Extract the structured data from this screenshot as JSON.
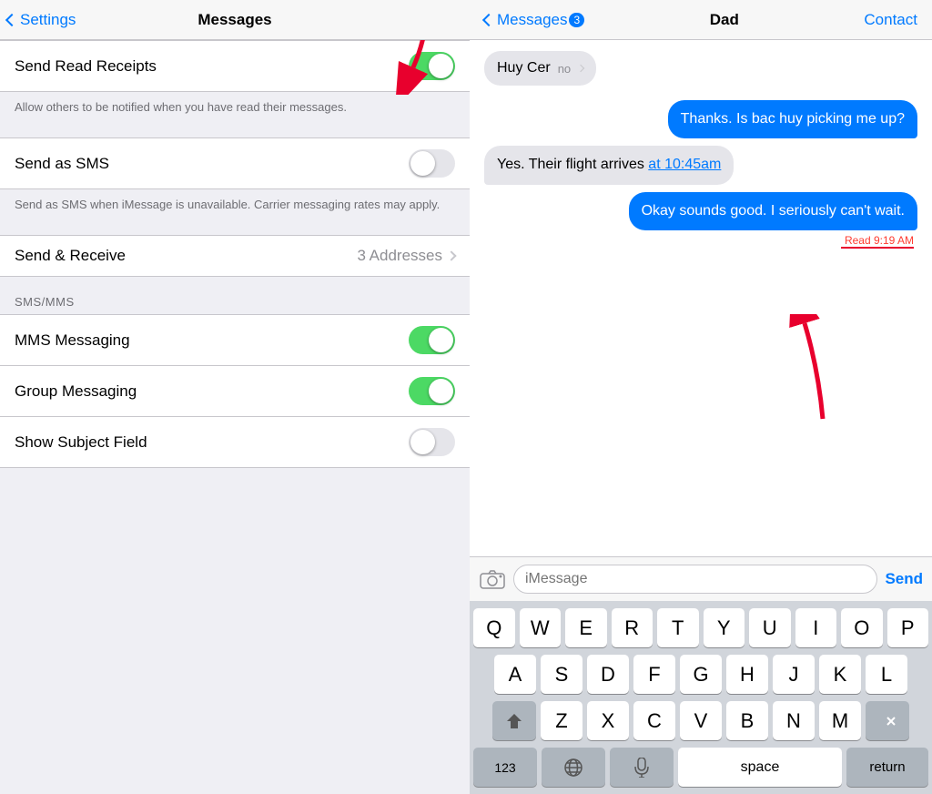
{
  "settings": {
    "nav": {
      "back_label": "Settings",
      "title": "Messages"
    },
    "items": {
      "send_read_receipts": {
        "label": "Send Read Receipts",
        "toggle_state": "on",
        "description": "Allow others to be notified when you have read their messages."
      },
      "send_as_sms": {
        "label": "Send as SMS",
        "toggle_state": "off",
        "description": "Send as SMS when iMessage is unavailable. Carrier messaging rates may apply."
      },
      "send_receive": {
        "label": "Send & Receive",
        "value": "3 Addresses"
      },
      "section_smsmms": "SMS/MMS",
      "mms_messaging": {
        "label": "MMS Messaging",
        "toggle_state": "on"
      },
      "group_messaging": {
        "label": "Group Messaging",
        "toggle_state": "on"
      },
      "show_subject_field": {
        "label": "Show Subject Field",
        "toggle_state": "off"
      }
    }
  },
  "messages": {
    "nav": {
      "back_label": "Messages (3)",
      "title": "Dad",
      "contact_label": "Contact"
    },
    "conversation": [
      {
        "type": "incoming",
        "partial": true,
        "text": "Huy Cer",
        "time": "no"
      },
      {
        "type": "outgoing",
        "text": "Thanks. Is bac huy picking me up?"
      },
      {
        "type": "incoming",
        "text": "Yes. Their flight arrives at 10:45am",
        "has_link": true,
        "link_text": "at 10:45am"
      },
      {
        "type": "outgoing",
        "text": "Okay sounds good. I seriously can't wait."
      }
    ],
    "read_receipt": "Read 9:19 AM",
    "input_placeholder": "iMessage",
    "send_label": "Send"
  },
  "keyboard": {
    "row1": [
      "Q",
      "W",
      "E",
      "R",
      "T",
      "Y",
      "U",
      "I",
      "O",
      "P"
    ],
    "row2": [
      "A",
      "S",
      "D",
      "F",
      "G",
      "H",
      "J",
      "K",
      "L"
    ],
    "row3": [
      "Z",
      "X",
      "C",
      "V",
      "B",
      "N",
      "M"
    ],
    "bottom": {
      "numbers": "123",
      "globe": "🌐",
      "mic": "🎤",
      "space": "space",
      "return": "return"
    }
  }
}
